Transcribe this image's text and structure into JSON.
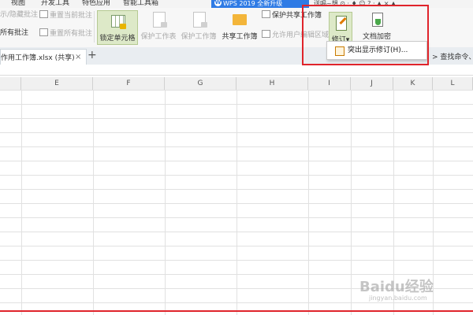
{
  "menubar": {
    "items": [
      "视图",
      "开发工具",
      "特色应用",
      "智能工具箱"
    ],
    "promo": "WPS 2019 全新升级",
    "user": "送喝~想 ⊙ · ♦ ☺ ? · ▲ × ▲"
  },
  "ribbon": {
    "show_hide_comments": "示/隐藏批注",
    "reset_current_comment": "重置当前批注",
    "all_comments": "所有批注",
    "reset_all_comments": "重置所有批注",
    "lock_cell": "锁定单元格",
    "protect_sheet": "保护工作表",
    "protect_workbook": "保护工作簿",
    "share_workbook": "共享工作簿",
    "protect_shared_workbook": "保护共享工作簿",
    "allow_edit_ranges": "允许用户编辑区域",
    "track_changes": "修订",
    "encrypt_document": "文档加密"
  },
  "dropdown": {
    "highlight_changes": "突出显示修订(H)..."
  },
  "tabbar": {
    "doc_tab": "作用工作簿.xlsx (共享)",
    "close": "×",
    "add": "+",
    "search": "> 查找命令、"
  },
  "grid": {
    "columns": [
      "E",
      "F",
      "G",
      "H",
      "I",
      "J",
      "K",
      "L"
    ]
  },
  "watermark": {
    "brand": "Baidu经验",
    "url": "jingyan.baidu.com"
  }
}
